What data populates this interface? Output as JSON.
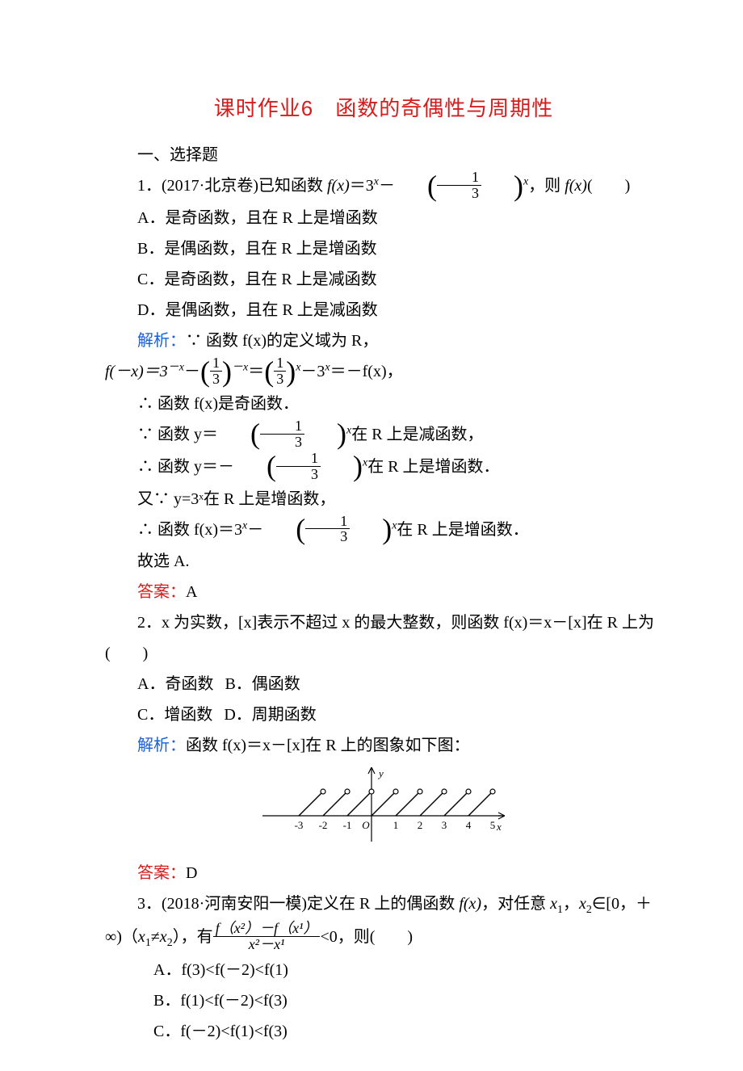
{
  "title": "课时作业6　函数的奇偶性与周期性",
  "section1": "一、选择题",
  "q1": {
    "head_a": "1．(2017·北京卷)已知函数 ",
    "head_b": "，则 ",
    "head_c": "(　　)",
    "fx_label": "f(x)",
    "eq": "＝3",
    "sx": "x",
    "minus": "－",
    "frac_num": "1",
    "frac_den": "3",
    "optA": "A．是奇函数，且在 R 上是增函数",
    "optB": "B．是偶函数，且在 R 上是增函数",
    "optC": "C．是奇函数，且在 R 上是减函数",
    "optD": "D．是偶函数，且在 R 上是减函数",
    "ana_label": "解析：",
    "ana1": "∵ 函数 f(x)的定义域为 R，",
    "eq_lhs": "f(－x)＝3",
    "sup_negx": "－x",
    "mid_minus": "－",
    "mid_eq": "＝",
    "rhs_minus": "－3",
    "rhs_eq_end": "＝－f(x)，",
    "ana_conc1": "∴ 函数 f(x)是奇函数．",
    "ana_y1a": "∵ 函数 y＝",
    "ana_y1b": "在 R 上是减函数，",
    "ana_y2a": "∴ 函数 y＝－",
    "ana_y2b": "在 R 上是增函数．",
    "ana_y3": "又∵ y=3ˣ在 R 上是增函数，",
    "ana_y4a": "∴ 函数 f(x)＝3",
    "ana_y4b": "在 R 上是增函数．",
    "ana_end": "故选 A.",
    "ans_label": "答案：",
    "ans_val": "A"
  },
  "q2": {
    "line1": "2．x 为实数，[x]表示不超过 x 的最大整数，则函数 f(x)＝x－[x]在 R 上为(　　)",
    "optA": "A．奇函数",
    "optB": "B．偶函数",
    "optC": "C．增函数",
    "optD": "D．周期函数",
    "ana_label": "解析：",
    "ana_body": "函数 f(x)＝x－[x]在 R 上的图象如下图：",
    "axis_y": "y",
    "axis_x": "x",
    "ticks": [
      "-3",
      "-2",
      "-1",
      "O",
      "1",
      "2",
      "3",
      "4",
      "5"
    ],
    "ans_label": "答案：",
    "ans_val": "D"
  },
  "q3": {
    "line1a": "3．(2018·河南安阳一模)定义在 R 上的偶函数 ",
    "line1_fx": "f(x)",
    "line1b": "，对任意 ",
    "x1": "x",
    "sub1": "1",
    "x2": "x",
    "sub2": "2",
    "line1c": "∈[0，＋",
    "line2a": "∞)（",
    "neq": "≠",
    "line2b": "），有",
    "frac_num": "f（x²）－f（x¹）",
    "frac_den": "x²－x¹",
    "line2c": "<0，则(　　)",
    "optA": "A．f(3)<f(－2)<f(1)",
    "optB": "B．f(1)<f(－2)<f(3)",
    "optC": "C．f(－2)<f(1)<f(3)"
  }
}
